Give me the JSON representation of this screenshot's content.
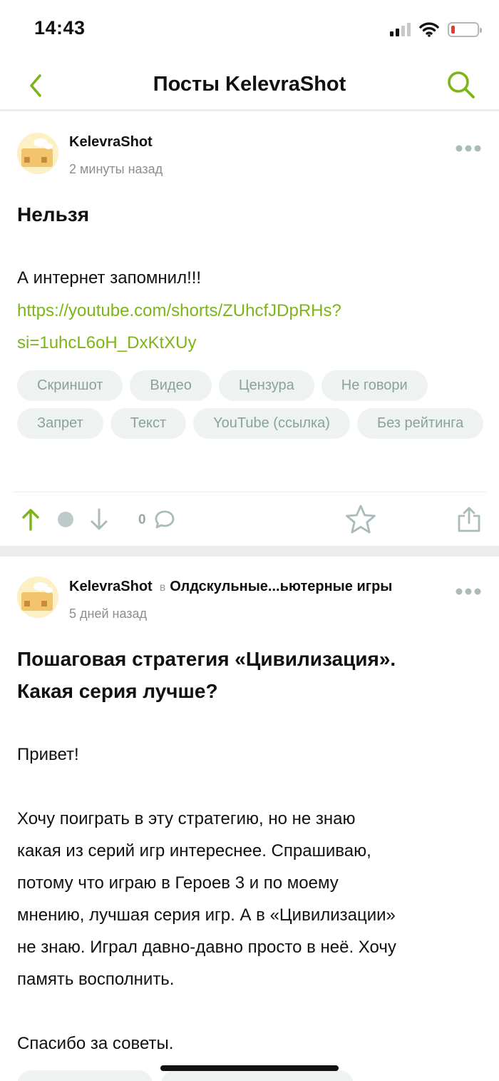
{
  "status_bar": {
    "time": "14:43"
  },
  "nav": {
    "title": "Посты KelevraShot",
    "accent_color": "#7cb518"
  },
  "posts": [
    {
      "author": "KelevraShot",
      "time": "2 минуты назад",
      "title": "Нельзя",
      "text": "А интернет запомнил!!!",
      "link_line1": "https://youtube.com/shorts/ZUhcfJDpRHs?",
      "link_line2": "si=1uhcL6oH_DxKtXUy",
      "tags": [
        "Скриншот",
        "Видео",
        "Цензура",
        "Не говори",
        "Запрет",
        "Текст",
        "YouTube (ссылка)",
        "Без рейтинга"
      ],
      "comments_count": "0"
    },
    {
      "author": "KelevraShot",
      "community_prefix": "в",
      "community": "Олдскульные...ьютерные игры",
      "time": "5 дней назад",
      "title_line1": "Пошаговая стратегия «Цивилизация».",
      "title_line2": "Какая серия лучше?",
      "greeting": "Привет!",
      "body_lines": [
        "Хочу поиграть в эту стратегию, но не знаю",
        "какая из серий игр интереснее. Спрашиваю,",
        "потому что играю в Героев 3 и по моему",
        "мнению, лучшая серия игр. А в «Цивилизации»",
        "не знаю. Играл давно-давно просто в неё. Хочу",
        "память восполнить."
      ],
      "thanks": "Спасибо за советы."
    }
  ],
  "icons": {
    "back": "chevron-left-icon",
    "search": "search-icon",
    "more": "more-dots-icon",
    "upvote": "arrow-up-icon",
    "downvote": "arrow-down-icon",
    "comment": "comment-bubble-icon",
    "save": "star-icon",
    "share": "share-icon"
  }
}
